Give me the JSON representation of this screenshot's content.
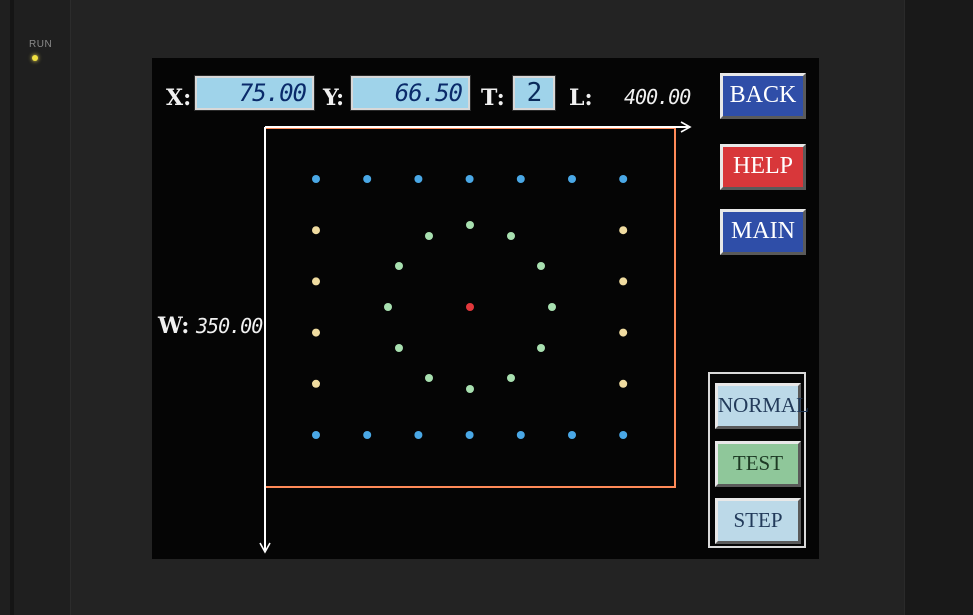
{
  "indicator": {
    "label": "RUN"
  },
  "readouts": {
    "x_label": "X:",
    "x_value": "75.00",
    "y_label": "Y:",
    "y_value": "66.50",
    "t_label": "T:",
    "t_value": "2",
    "l_label": "L:",
    "l_value": "400.00",
    "w_label": "W:",
    "w_value": "350.00"
  },
  "nav": {
    "back": "BACK",
    "help": "HELP",
    "main": "MAIN"
  },
  "modes": {
    "normal": "NORMAL",
    "test": "TEST",
    "step": "STEP"
  },
  "colors": {
    "blue_point": "#4aa8e6",
    "yellow_point": "#f0dca0",
    "green_point": "#a8e0b0",
    "red_point": "#e2383c",
    "boundary": "#ff8a58"
  },
  "points": {
    "grid_cols": 7,
    "grid_rows": 6,
    "ring_count": 12,
    "center": "red"
  }
}
